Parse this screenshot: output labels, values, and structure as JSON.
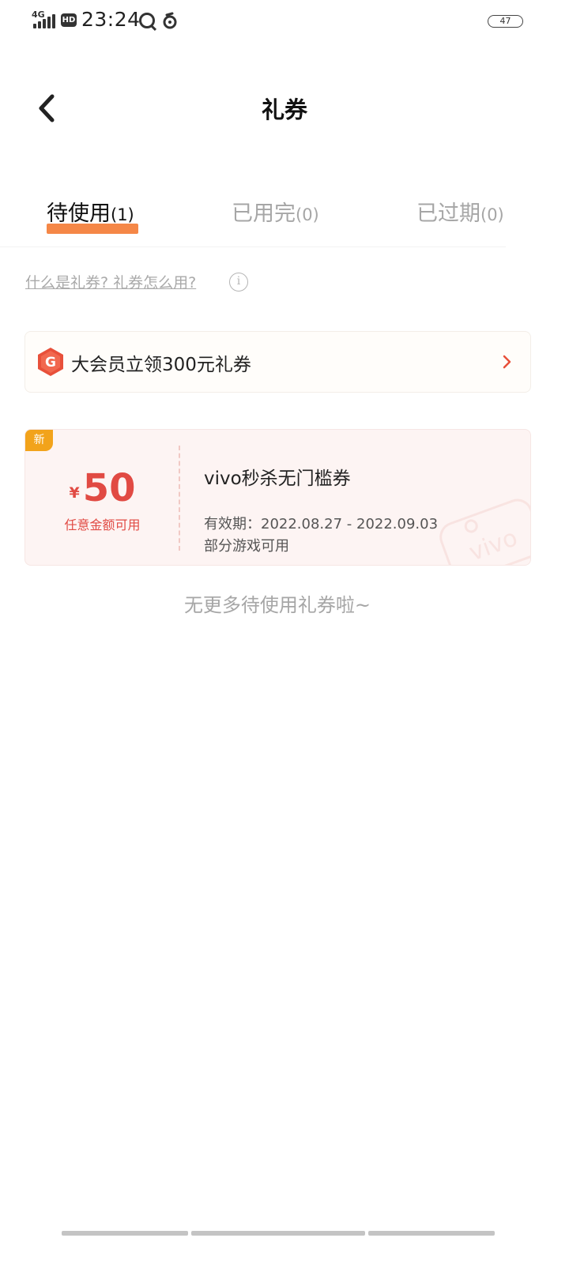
{
  "status_bar": {
    "network": "4G",
    "hd": "HD",
    "time": "23:24",
    "battery": "47"
  },
  "header": {
    "title": "礼券"
  },
  "tabs": [
    {
      "label": "待使用",
      "count": "(1)",
      "active": true
    },
    {
      "label": "已用完",
      "count": "(0)",
      "active": false
    },
    {
      "label": "已过期",
      "count": "(0)",
      "active": false
    }
  ],
  "help": {
    "link_text": "什么是礼券? 礼券怎么用?",
    "info_glyph": "i"
  },
  "promo": {
    "logo_letter": "G",
    "text": "大会员立领300元礼券"
  },
  "coupon": {
    "badge": "新",
    "currency": "¥",
    "amount": "50",
    "amount_desc": "任意金额可用",
    "title": "vivo秒杀无门槛券",
    "validity": "有效期：2022.08.27 - 2022.09.03",
    "scope": "部分游戏可用",
    "watermark": "vivo"
  },
  "list_end": {
    "text": "无更多待使用礼券啦~"
  },
  "colors": {
    "accent": "#f58747",
    "coupon_red": "#e14a43",
    "badge_orange": "#f2a31b",
    "inactive_text": "#a6a6a6"
  }
}
